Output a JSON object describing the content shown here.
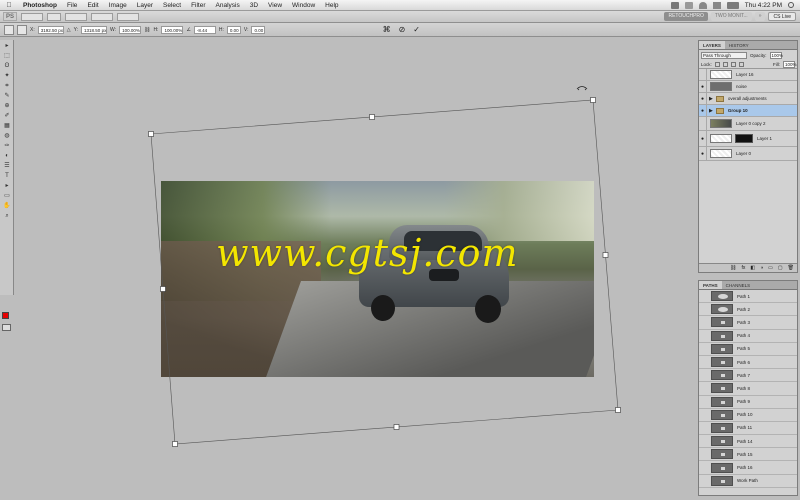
{
  "menubar": {
    "apple": "",
    "app_name": "Photoshop",
    "menus": [
      "File",
      "Edit",
      "Image",
      "Layer",
      "Select",
      "Filter",
      "Analysis",
      "3D",
      "View",
      "Window",
      "Help"
    ],
    "clock": "Thu 4:22 PM"
  },
  "appbar": {
    "logo": "PS",
    "workspace_active": "RETOUCHPRO",
    "workspace_inactive": "TWO MONIT...",
    "cs_live": "CS Live"
  },
  "options": {
    "x_label": "X:",
    "x_value": "3192.50 px",
    "y_label": "Y:",
    "y_value": "1318.50 px",
    "w_label": "W:",
    "w_value": "100.00%",
    "h_label": "H:",
    "h_value": "100.00%",
    "angle_value": "-8.44",
    "h_skew_label": "H:",
    "h_skew_value": "0.00",
    "v_skew_label": "V:",
    "v_skew_value": "0.00",
    "cancel_icon": "⊘",
    "commit_icon": "✓"
  },
  "toolbox": {
    "tools": [
      "▸",
      "⬚",
      "ʘ",
      "✦",
      "⌗",
      "✎",
      "⊕",
      "✐",
      "▦",
      "◍",
      "✑",
      "◐",
      "☰",
      "T",
      "▸",
      "▭",
      "✋",
      "⌕"
    ]
  },
  "canvas": {
    "watermark": "www.cgtsj.com"
  },
  "layers_panel": {
    "tab_layers": "LAYERS",
    "tab_history": "HISTORY",
    "blend_mode": "Pass Through",
    "opacity_label": "Opacity:",
    "opacity_value": "100%",
    "lock_label": "Lock:",
    "fill_label": "Fill:",
    "fill_value": "100%",
    "layers": [
      {
        "name": "Layer 16",
        "visible": false,
        "thumb": "transparent"
      },
      {
        "name": "noise",
        "visible": true,
        "thumb": "dark"
      },
      {
        "name": "overall adjustments",
        "visible": true,
        "thumb": "folder"
      },
      {
        "name": "Group 10",
        "visible": true,
        "thumb": "folder",
        "selected": true
      },
      {
        "name": "Layer 0 copy 2",
        "visible": false,
        "thumb": "photo"
      },
      {
        "name": "Layer 1",
        "visible": true,
        "thumb": "mask"
      },
      {
        "name": "Layer 0",
        "visible": true,
        "thumb": "transparent"
      }
    ],
    "footer_icons": [
      "⛓",
      "fx",
      "◧",
      "◑",
      "▭",
      "▢",
      "🗑"
    ]
  },
  "paths_panel": {
    "tab_paths": "PATHS",
    "tab_channels": "CHANNELS",
    "paths": [
      "Path 1",
      "Path 2",
      "Path 3",
      "Path 4",
      "Path 5",
      "Path 6",
      "Path 7",
      "Path 8",
      "Path 9",
      "Path 10",
      "Path 11",
      "Path 14",
      "Path 15",
      "Path 16",
      "Work Path"
    ]
  },
  "colors": {
    "foreground_swatch": "#e60000",
    "watermark": "#f3e600",
    "selection": "#a9c8ea"
  }
}
